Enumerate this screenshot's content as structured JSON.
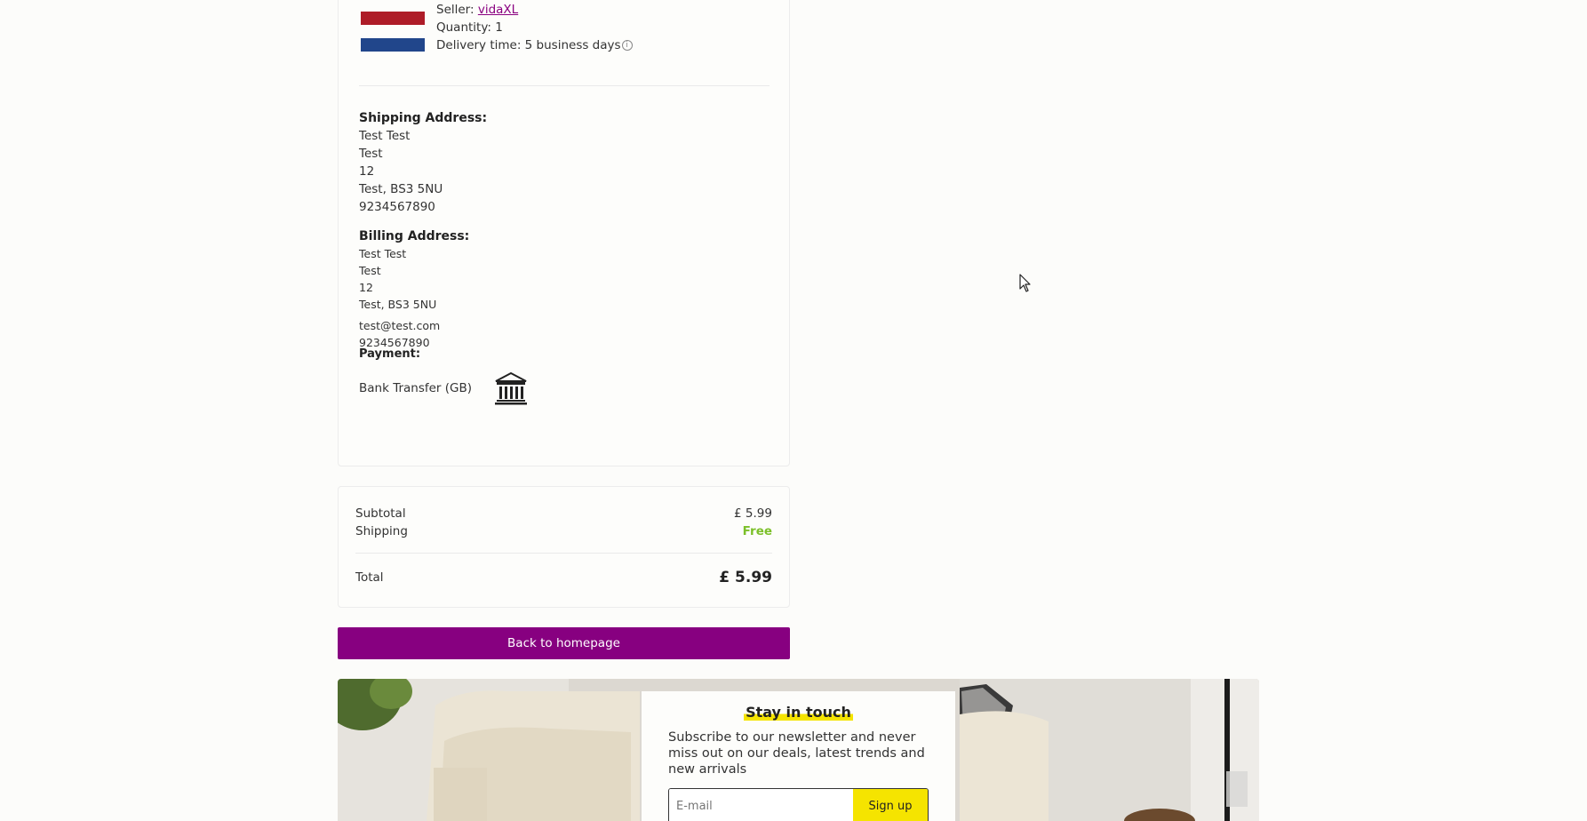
{
  "item": {
    "seller_label": "Seller: ",
    "seller_name": "vidaXL",
    "quantity": "Quantity: 1",
    "delivery": "Delivery time: 5 business days",
    "info_glyph": "i"
  },
  "shipping": {
    "heading": "Shipping Address:",
    "lines": [
      "Test Test",
      "Test",
      "12",
      "Test, BS3 5NU",
      "9234567890"
    ]
  },
  "billing": {
    "heading": "Billing Address:",
    "lines": [
      "Test Test",
      "Test",
      "12",
      "Test, BS3 5NU"
    ],
    "email": "test@test.com",
    "phone": "9234567890"
  },
  "payment": {
    "heading": "Payment:",
    "method": "Bank Transfer (GB)",
    "icon": "bank-icon"
  },
  "totals": {
    "subtotal_label": "Subtotal",
    "subtotal_value": "£ 5.99",
    "shipping_label": "Shipping",
    "shipping_value": "Free",
    "total_label": "Total",
    "total_value": "£ 5.99"
  },
  "buttons": {
    "back_home": "Back to homepage"
  },
  "newsletter": {
    "title": "Stay in touch",
    "text": "Subscribe to our newsletter and never miss out on our deals, latest trends and new arrivals",
    "email_placeholder": "E-mail",
    "signup_label": "Sign up"
  },
  "colors": {
    "brand_purple": "#870080",
    "free_green": "#7cc02a",
    "accent_yellow": "#f5e400"
  }
}
